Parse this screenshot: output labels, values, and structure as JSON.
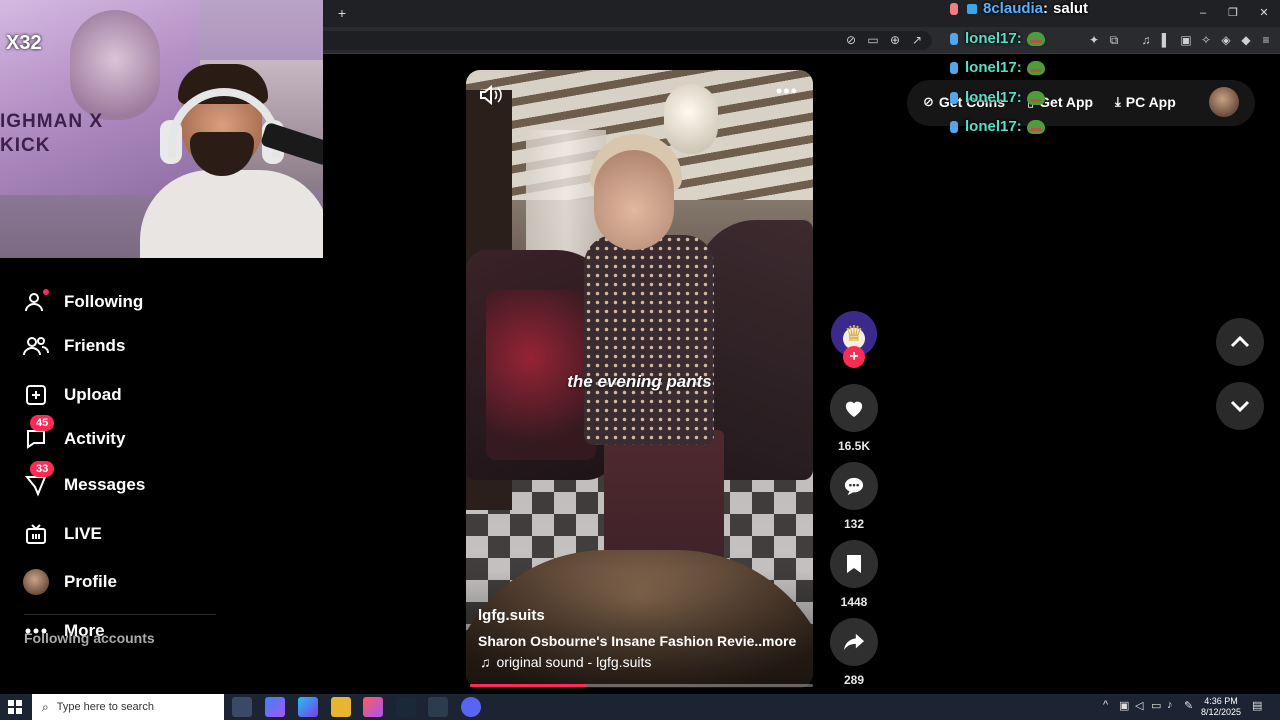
{
  "browser": {
    "new_tab_glyph": "+",
    "window_controls": [
      "–",
      "❐",
      "✕"
    ]
  },
  "sidebar": {
    "items": [
      {
        "label": "Following",
        "icon": "following-icon"
      },
      {
        "label": "Friends",
        "icon": "friends-icon"
      },
      {
        "label": "Upload",
        "icon": "upload-icon"
      },
      {
        "label": "Activity",
        "icon": "activity-icon",
        "badge": "45"
      },
      {
        "label": "Messages",
        "icon": "messages-icon",
        "badge": "33"
      },
      {
        "label": "LIVE",
        "icon": "live-icon"
      },
      {
        "label": "Profile",
        "icon": "profile-avatar"
      },
      {
        "label": "More",
        "icon": "more-icon"
      }
    ],
    "section_title": "Following accounts"
  },
  "webcam": {
    "logo_text": "X32",
    "poster_text": "IGHMAN X KICK"
  },
  "video": {
    "caption": "the evening pants",
    "author": "lgfg.suits",
    "description": "Sharon Osbourne's Insane Fashion Revie...",
    "more_label": "more",
    "sound": "original sound - lgfg.suits",
    "progress": 0.34
  },
  "actions": {
    "likes": "16.5K",
    "comments": "132",
    "saves": "1448",
    "shares": "289"
  },
  "header": {
    "get_coins": "Get Coins",
    "get_app": "Get App",
    "pc_app": "PC App"
  },
  "chat": [
    {
      "user": "8claudia",
      "message": "salut"
    },
    {
      "user": "lonel17",
      "message": ""
    },
    {
      "user": "lonel17",
      "message": ""
    },
    {
      "user": "lonel17",
      "message": ""
    },
    {
      "user": "lonel17",
      "message": ""
    }
  ],
  "taskbar": {
    "search_placeholder": "Type here to search",
    "time": "4:36 PM",
    "date": "8/12/2025"
  },
  "colors": {
    "accent": "#fe2c55",
    "chat_user_claudia": "#5ab2ff",
    "chat_user_lonel": "#55e0c8"
  }
}
